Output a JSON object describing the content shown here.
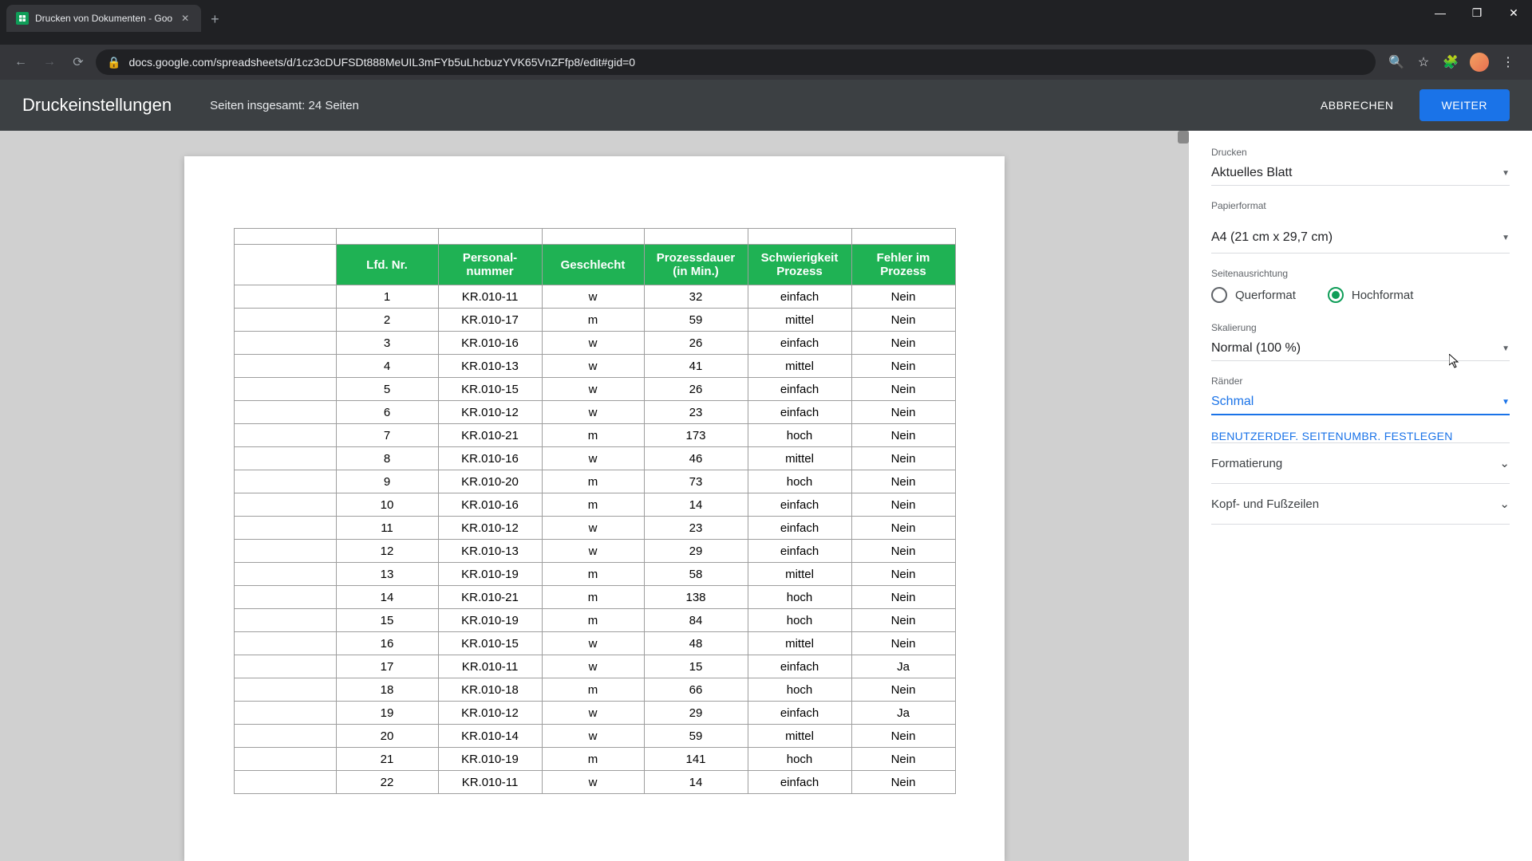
{
  "browser": {
    "tab_title": "Drucken von Dokumenten - Goo",
    "url": "docs.google.com/spreadsheets/d/1cz3cDUFSDt888MeUIL3mFYb5uLhcbuzYVK65VnZFfp8/edit#gid=0"
  },
  "header": {
    "title": "Druckeinstellungen",
    "subtitle": "Seiten insgesamt: 24 Seiten",
    "cancel": "ABBRECHEN",
    "next": "WEITER"
  },
  "settings": {
    "print_label": "Drucken",
    "print_value": "Aktuelles Blatt",
    "paper_label": "Papierformat",
    "paper_value": "A4 (21 cm x 29,7 cm)",
    "orientation_label": "Seitenausrichtung",
    "orientation_landscape": "Querformat",
    "orientation_portrait": "Hochformat",
    "scale_label": "Skalierung",
    "scale_value": "Normal (100 %)",
    "margins_label": "Ränder",
    "margins_value": "Schmal",
    "custom_breaks": "BENUTZERDEF. SEITENUMBR. FESTLEGEN",
    "formatting": "Formatierung",
    "headers_footers": "Kopf- und Fußzeilen"
  },
  "table": {
    "headers": [
      "Lfd. Nr.",
      "Personal-nummer",
      "Geschlecht",
      "Prozessdauer (in Min.)",
      "Schwierigkeit Prozess",
      "Fehler im Prozess"
    ],
    "rows": [
      [
        "1",
        "KR.010-11",
        "w",
        "32",
        "einfach",
        "Nein"
      ],
      [
        "2",
        "KR.010-17",
        "m",
        "59",
        "mittel",
        "Nein"
      ],
      [
        "3",
        "KR.010-16",
        "w",
        "26",
        "einfach",
        "Nein"
      ],
      [
        "4",
        "KR.010-13",
        "w",
        "41",
        "mittel",
        "Nein"
      ],
      [
        "5",
        "KR.010-15",
        "w",
        "26",
        "einfach",
        "Nein"
      ],
      [
        "6",
        "KR.010-12",
        "w",
        "23",
        "einfach",
        "Nein"
      ],
      [
        "7",
        "KR.010-21",
        "m",
        "173",
        "hoch",
        "Nein"
      ],
      [
        "8",
        "KR.010-16",
        "w",
        "46",
        "mittel",
        "Nein"
      ],
      [
        "9",
        "KR.010-20",
        "m",
        "73",
        "hoch",
        "Nein"
      ],
      [
        "10",
        "KR.010-16",
        "m",
        "14",
        "einfach",
        "Nein"
      ],
      [
        "11",
        "KR.010-12",
        "w",
        "23",
        "einfach",
        "Nein"
      ],
      [
        "12",
        "KR.010-13",
        "w",
        "29",
        "einfach",
        "Nein"
      ],
      [
        "13",
        "KR.010-19",
        "m",
        "58",
        "mittel",
        "Nein"
      ],
      [
        "14",
        "KR.010-21",
        "m",
        "138",
        "hoch",
        "Nein"
      ],
      [
        "15",
        "KR.010-19",
        "m",
        "84",
        "hoch",
        "Nein"
      ],
      [
        "16",
        "KR.010-15",
        "w",
        "48",
        "mittel",
        "Nein"
      ],
      [
        "17",
        "KR.010-11",
        "w",
        "15",
        "einfach",
        "Ja"
      ],
      [
        "18",
        "KR.010-18",
        "m",
        "66",
        "hoch",
        "Nein"
      ],
      [
        "19",
        "KR.010-12",
        "w",
        "29",
        "einfach",
        "Ja"
      ],
      [
        "20",
        "KR.010-14",
        "w",
        "59",
        "mittel",
        "Nein"
      ],
      [
        "21",
        "KR.010-19",
        "m",
        "141",
        "hoch",
        "Nein"
      ],
      [
        "22",
        "KR.010-11",
        "w",
        "14",
        "einfach",
        "Nein"
      ]
    ]
  }
}
